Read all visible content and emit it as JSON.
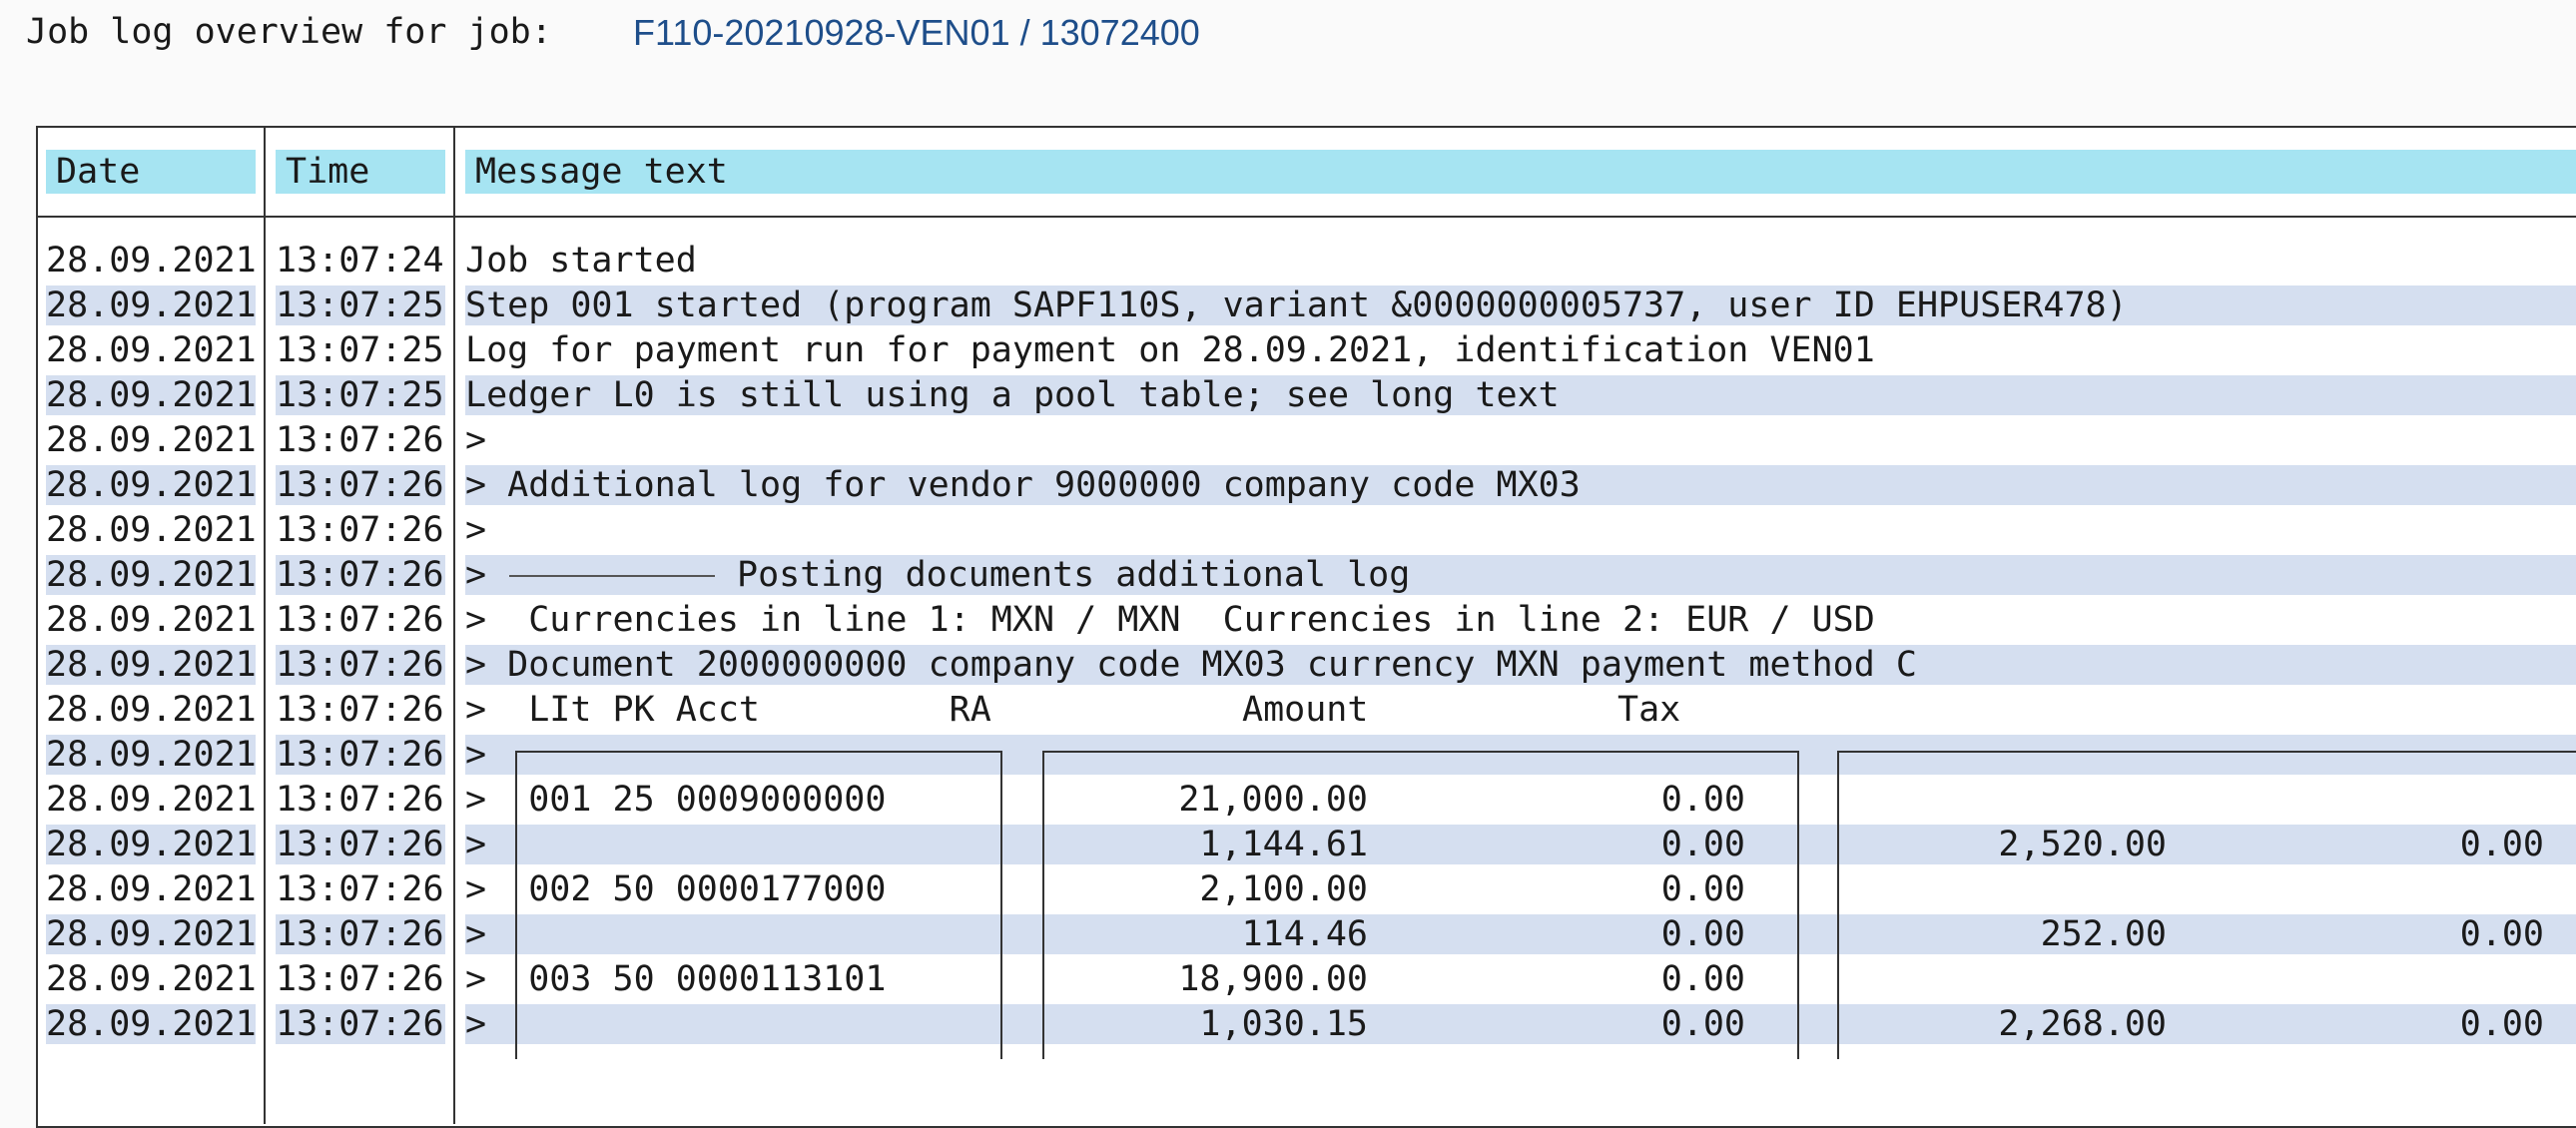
{
  "header": {
    "title": "Job log overview for job:",
    "job_id": "F110-20210928-VEN01 / 13072400"
  },
  "columns": {
    "date": "Date",
    "time": "Time",
    "message": "Message text"
  },
  "rows": [
    {
      "date": "28.09.2021",
      "time": "13:07:24",
      "msg": "Job started"
    },
    {
      "date": "28.09.2021",
      "time": "13:07:25",
      "msg": "Step 001 started (program SAPF110S, variant &0000000005737, user ID EHPUSER478)"
    },
    {
      "date": "28.09.2021",
      "time": "13:07:25",
      "msg": "Log for payment run for payment on 28.09.2021, identification VEN01"
    },
    {
      "date": "28.09.2021",
      "time": "13:07:25",
      "msg": "Ledger L0 is still using a pool table; see long text"
    },
    {
      "date": "28.09.2021",
      "time": "13:07:26",
      "msg": ">"
    },
    {
      "date": "28.09.2021",
      "time": "13:07:26",
      "msg": "> Additional log for vendor 9000000 company code MX03"
    },
    {
      "date": "28.09.2021",
      "time": "13:07:26",
      "msg": ">"
    },
    {
      "date": "28.09.2021",
      "time": "13:07:26",
      "msg": ">"
    },
    {
      "date": "28.09.2021",
      "time": "13:07:26",
      "msg": ">  Currencies in line 1: MXN / MXN  Currencies in line 2: EUR / USD"
    },
    {
      "date": "28.09.2021",
      "time": "13:07:26",
      "msg": "> Document 2000000000 company code MX03 currency MXN payment method C"
    },
    {
      "date": "28.09.2021",
      "time": "13:07:26",
      "msg": ">  LIt PK Acct         RA"
    },
    {
      "date": "28.09.2021",
      "time": "13:07:26",
      "msg": ">"
    },
    {
      "date": "28.09.2021",
      "time": "13:07:26",
      "msg": ">  001 25 0009000000"
    },
    {
      "date": "28.09.2021",
      "time": "13:07:26",
      "msg": ">"
    },
    {
      "date": "28.09.2021",
      "time": "13:07:26",
      "msg": ">  002 50 0000177000"
    },
    {
      "date": "28.09.2021",
      "time": "13:07:26",
      "msg": ">"
    },
    {
      "date": "28.09.2021",
      "time": "13:07:26",
      "msg": ">  003 50 0000113101"
    },
    {
      "date": "28.09.2021",
      "time": "13:07:26",
      "msg": ">"
    }
  ],
  "posting_title": "Posting documents additional log",
  "col_headers": {
    "amount": "Amount",
    "tax": "Tax"
  },
  "amounts": {
    "r12": {
      "amt": "21,000.00",
      "tax": "0.00",
      "amt2": "",
      "tax2": ""
    },
    "r13": {
      "amt": "1,144.61",
      "tax": "0.00",
      "amt2": "2,520.00",
      "tax2": "0.00"
    },
    "r14": {
      "amt": "2,100.00",
      "tax": "0.00",
      "amt2": "",
      "tax2": ""
    },
    "r15": {
      "amt": "114.46",
      "tax": "0.00",
      "amt2": "252.00",
      "tax2": "0.00"
    },
    "r16": {
      "amt": "18,900.00",
      "tax": "0.00",
      "amt2": "",
      "tax2": ""
    },
    "r17": {
      "amt": "1,030.15",
      "tax": "0.00",
      "amt2": "2,268.00",
      "tax2": "0.00"
    }
  }
}
